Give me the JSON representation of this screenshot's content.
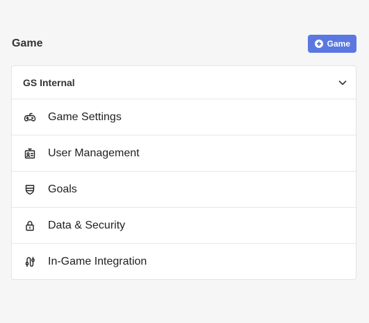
{
  "header": {
    "title": "Game",
    "add_button_label": "Game"
  },
  "section": {
    "title": "GS Internal",
    "items": [
      {
        "label": "Game Settings",
        "icon": "gamepad-icon"
      },
      {
        "label": "User Management",
        "icon": "id-badge-icon"
      },
      {
        "label": "Goals",
        "icon": "shield-icon"
      },
      {
        "label": "Data & Security",
        "icon": "lock-icon"
      },
      {
        "label": "In-Game Integration",
        "icon": "integration-icon"
      }
    ]
  },
  "colors": {
    "accent": "#5b78e0",
    "background": "#f6f6f6",
    "card": "#ffffff",
    "border": "#e6e6e6"
  }
}
